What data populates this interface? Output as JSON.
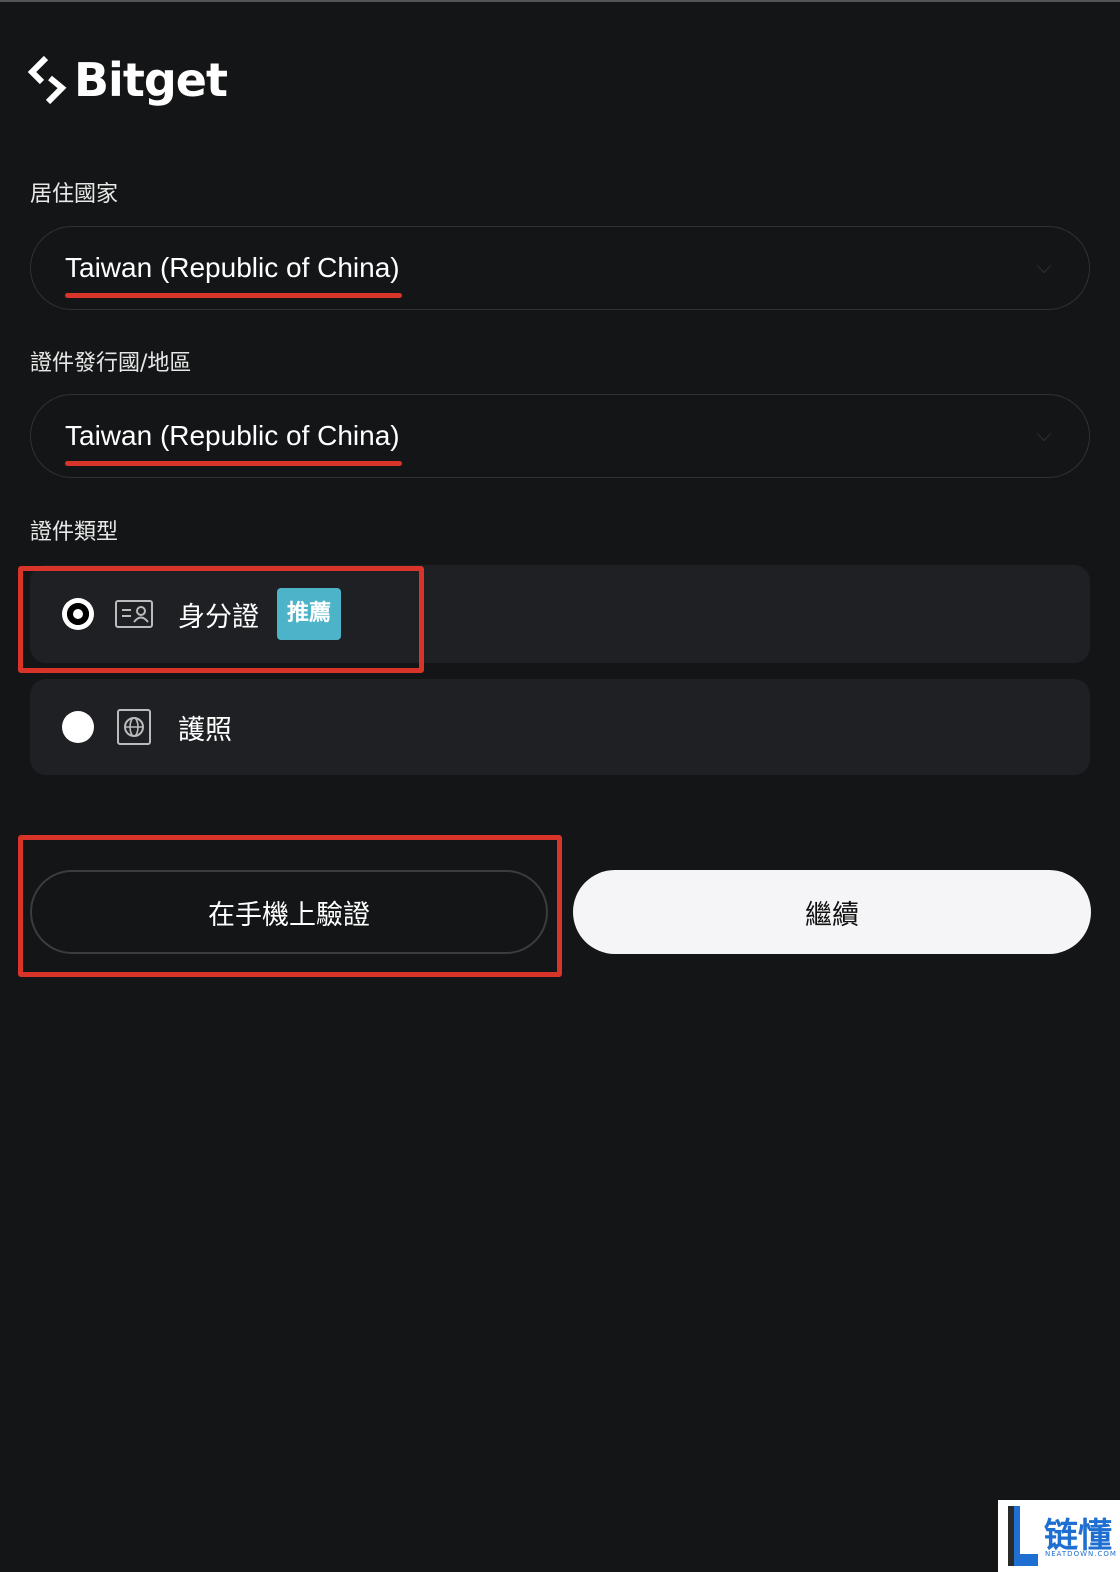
{
  "brand": {
    "name": "Bitget"
  },
  "form": {
    "residence_label": "居住國家",
    "residence_value": "Taiwan (Republic of China)",
    "issuer_label": "證件發行國/地區",
    "issuer_value": "Taiwan (Republic of China)",
    "doc_type_label": "證件類型",
    "options": [
      {
        "label": "身分證",
        "badge": "推薦",
        "selected": true,
        "icon": "id-card-icon"
      },
      {
        "label": "護照",
        "selected": false,
        "icon": "passport-icon"
      }
    ]
  },
  "actions": {
    "verify_on_phone": "在手機上驗證",
    "continue": "繼續"
  },
  "watermark": {
    "text": "链懂",
    "subtext": "NEATDOWN.COM"
  },
  "colors": {
    "background": "#141516",
    "accent_badge": "#4db3c9",
    "annotation_red": "#d8342a"
  }
}
